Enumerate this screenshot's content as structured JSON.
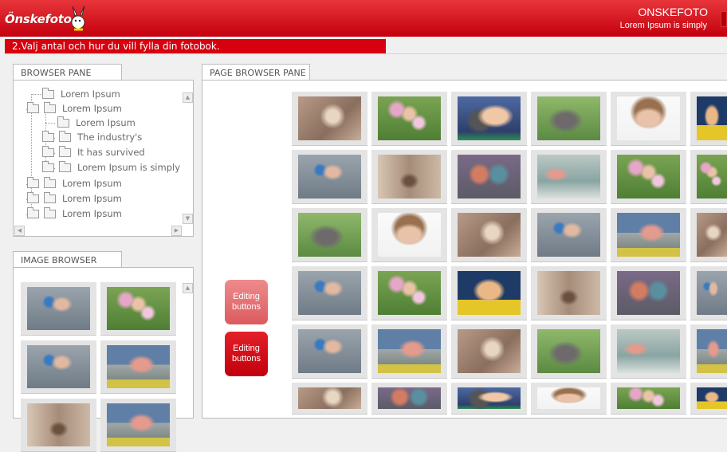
{
  "app": {
    "logo_text": "Önskefoto",
    "brand_title": "ONSKEFOTO",
    "brand_subtitle": "Lorem Ipsum is simply"
  },
  "step": {
    "label": "2.Valj antal och hur du vill fylla din fotobok."
  },
  "browser_pane": {
    "tab_label": "BROWSER PANE",
    "tree": [
      {
        "label": "Lorem Ipsum",
        "level": 0
      },
      {
        "label": "Lorem Ipsum",
        "level": 0
      },
      {
        "label": "Lorem Ipsum",
        "level": 2
      },
      {
        "label": "The industry's",
        "level": 1
      },
      {
        "label": "It has survived",
        "level": 1
      },
      {
        "label": "Lorem Ipsum is simply",
        "level": 1
      },
      {
        "label": "Lorem Ipsum",
        "level": 0
      },
      {
        "label": "Lorem Ipsum",
        "level": 0
      },
      {
        "label": "Lorem Ipsum",
        "level": 0
      }
    ]
  },
  "image_browser": {
    "tab_label": "IMAGE BROWSER",
    "thumbnails": [
      "child-in-water",
      "girl-in-flowers",
      "girl-splashing",
      "girl-on-beach",
      "alley",
      "girl-on-beach"
    ]
  },
  "page_browser": {
    "tab_label": "PAGE BROWSER PANE",
    "edit_buttons": [
      "Editing buttons",
      "Editing buttons"
    ],
    "colors": {
      "edit_button_light": "#e56c6f",
      "edit_button_dark": "#d10a15"
    }
  },
  "colors": {
    "brand_red": "#d7000f",
    "header_red": "#c4000e"
  }
}
